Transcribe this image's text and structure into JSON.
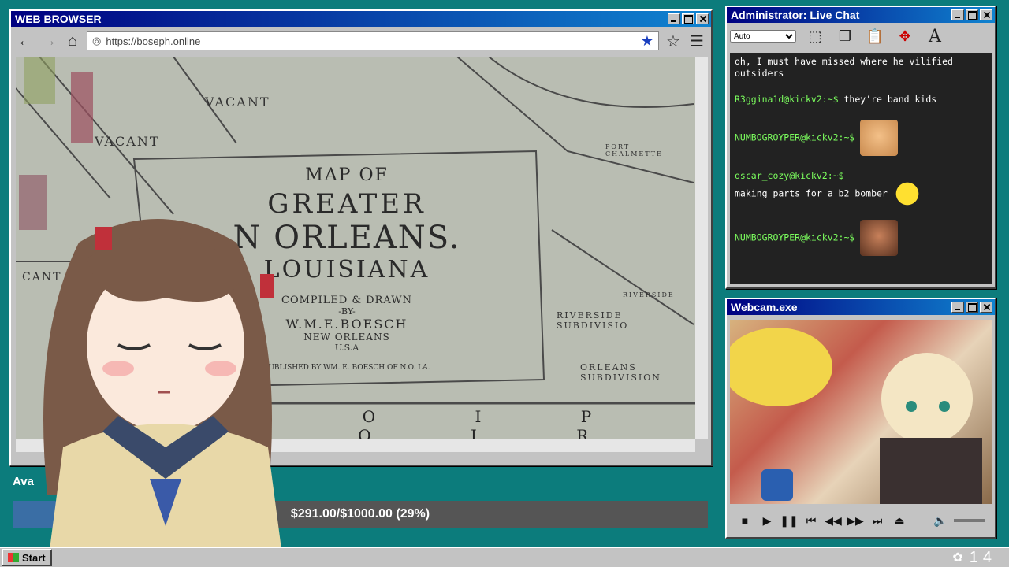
{
  "browser": {
    "title": "WEB BROWSER",
    "url": "https://boseph.online",
    "map": {
      "line1": "MAP OF",
      "line2": "GREATER",
      "line3": "N ORLEANS.",
      "line4": "LOUISIANA",
      "compiled": "COMPILED & DRAWN",
      "by": "-BY-",
      "author": "W.M.E.BOESCH",
      "city": "NEW ORLEANS",
      "country": "U.S.A",
      "published": "PUBLISHED  BY WM. E. BOESCH OF N.O. LA.",
      "labels": [
        "VACANT",
        "VACANT",
        "CANT",
        "RIVERSIDE SUBDIVISIO",
        "ORLEANS SUBDIVISION",
        "RIVERSIDE",
        "PORT CHALMETTE"
      ],
      "bottom": "T O I P I Q I R S"
    }
  },
  "chat": {
    "title": "Administrator: Live Chat",
    "font_select": "Auto",
    "messages": [
      {
        "user": "",
        "text": "oh, I must have missed where he vilified outsiders",
        "emote": ""
      },
      {
        "user": "R3ggina1d@kickv2:~$",
        "text": "they're band kids",
        "emote": ""
      },
      {
        "user": "NUMBOGROYPER@kickv2:~$",
        "text": "",
        "emote": "cat"
      },
      {
        "user": "oscar_cozy@kickv2:~$",
        "text": "making parts for a b2 bomber",
        "emote": "duck"
      },
      {
        "user": "NUMBOGROYPER@kickv2:~$",
        "text": "",
        "emote": "face"
      }
    ]
  },
  "webcam": {
    "title": "Webcam.exe"
  },
  "donation": {
    "label": "Ava",
    "text": "$291.00/$1000.00 (29%)",
    "progress": 0.29
  },
  "taskbar": {
    "start_label": "Start",
    "clock": "14"
  },
  "colors": {
    "desktop": "#0c7c7c",
    "titlebar": "#000080",
    "chat_user": "#7cff5e"
  }
}
